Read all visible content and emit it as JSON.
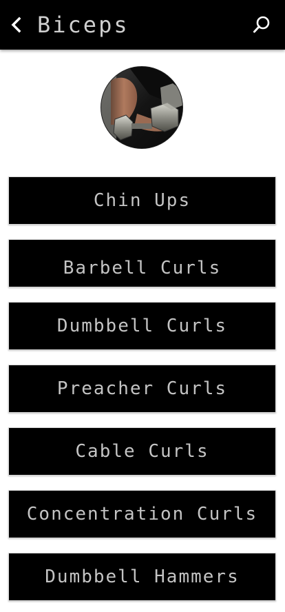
{
  "appbar": {
    "title": "Biceps",
    "back_icon": "chevron-left-icon",
    "search_icon": "search-icon",
    "background": "#000000",
    "title_color": "#cfcfcf"
  },
  "header_image": {
    "description_icon": "dumbbell-photo"
  },
  "exercises": [
    {
      "label": "Chin Ups"
    },
    {
      "label": "Barbell Curls"
    },
    {
      "label": "Dumbbell Curls"
    },
    {
      "label": "Preacher Curls"
    },
    {
      "label": "Cable Curls"
    },
    {
      "label": "Concentration Curls"
    },
    {
      "label": "Dumbbell Hammers"
    }
  ],
  "colors": {
    "button_bg": "#000000",
    "button_text": "#c4c4c4",
    "page_bg": "#ffffff"
  }
}
